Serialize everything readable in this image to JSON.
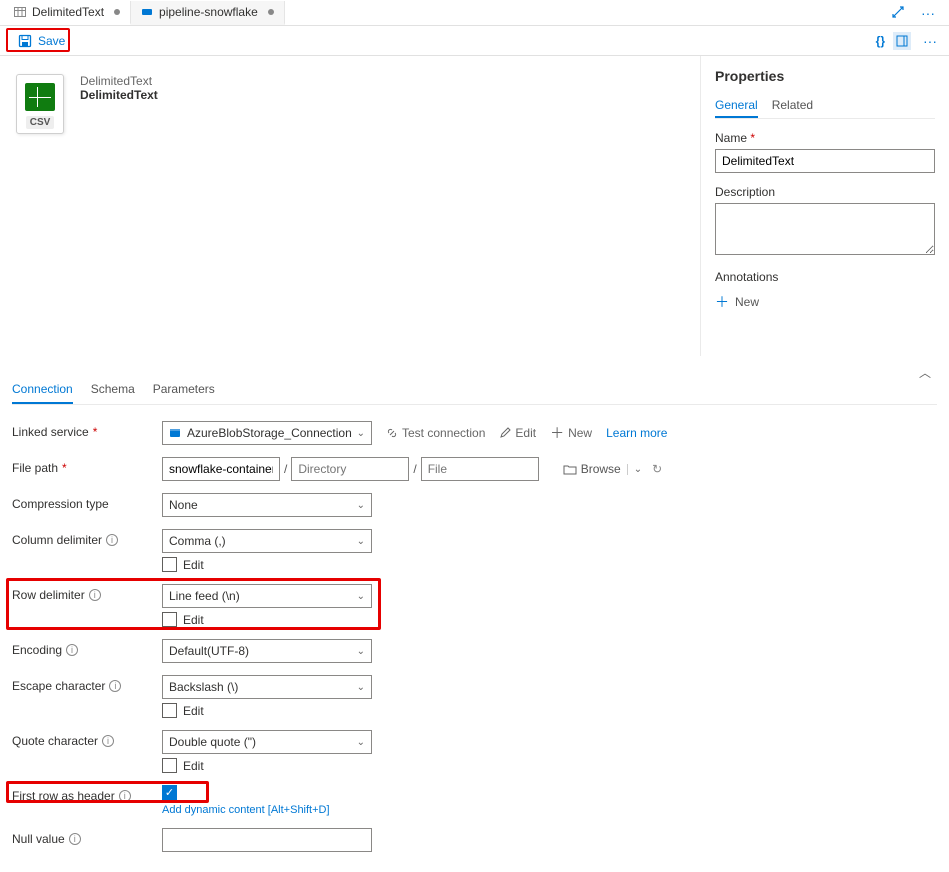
{
  "tabs": [
    {
      "label": "DelimitedText",
      "modified": true,
      "active": true
    },
    {
      "label": "pipeline-snowflake",
      "modified": true,
      "active": false
    }
  ],
  "toolbar": {
    "save_label": "Save"
  },
  "dataset": {
    "type_label": "DelimitedText",
    "name": "DelimitedText",
    "icon_text": "CSV"
  },
  "properties": {
    "title": "Properties",
    "tabs": {
      "general": "General",
      "related": "Related"
    },
    "name_label": "Name",
    "name_value": "DelimitedText",
    "description_label": "Description",
    "description_value": "",
    "annotations_label": "Annotations",
    "new_label": "New"
  },
  "section_tabs": {
    "connection": "Connection",
    "schema": "Schema",
    "parameters": "Parameters"
  },
  "conn": {
    "linked_service_label": "Linked service",
    "linked_service_value": "AzureBlobStorage_Connection",
    "test_connection": "Test connection",
    "edit": "Edit",
    "new": "New",
    "learn_more": "Learn more",
    "file_path_label": "File path",
    "fp_container": "snowflake-container",
    "fp_directory_ph": "Directory",
    "fp_file_ph": "File",
    "browse": "Browse",
    "compression_label": "Compression type",
    "compression_value": "None",
    "coldelim_label": "Column delimiter",
    "coldelim_value": "Comma (,)",
    "rowdelim_label": "Row delimiter",
    "rowdelim_value": "Line feed (\\n)",
    "encoding_label": "Encoding",
    "encoding_value": "Default(UTF-8)",
    "escape_label": "Escape character",
    "escape_value": "Backslash (\\)",
    "quote_label": "Quote character",
    "quote_value": "Double quote (\")",
    "firstrow_label": "First row as header",
    "nullvalue_label": "Null value",
    "nullvalue_value": "",
    "edit_chk": "Edit",
    "dyn_link": "Add dynamic content [Alt+Shift+D]"
  }
}
